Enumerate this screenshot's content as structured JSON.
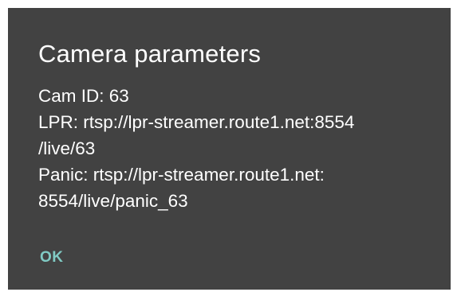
{
  "dialog": {
    "title": "Camera parameters",
    "lines": [
      "Cam ID: 63",
      "LPR: rtsp://lpr-streamer.route1.net:8554",
      "/live/63",
      "Panic: rtsp://lpr-streamer.route1.net:",
      "8554/live/panic_63"
    ],
    "ok_label": "OK"
  },
  "colors": {
    "dialog_background": "#424242",
    "text": "#ffffff",
    "accent": "#80cbc4"
  }
}
